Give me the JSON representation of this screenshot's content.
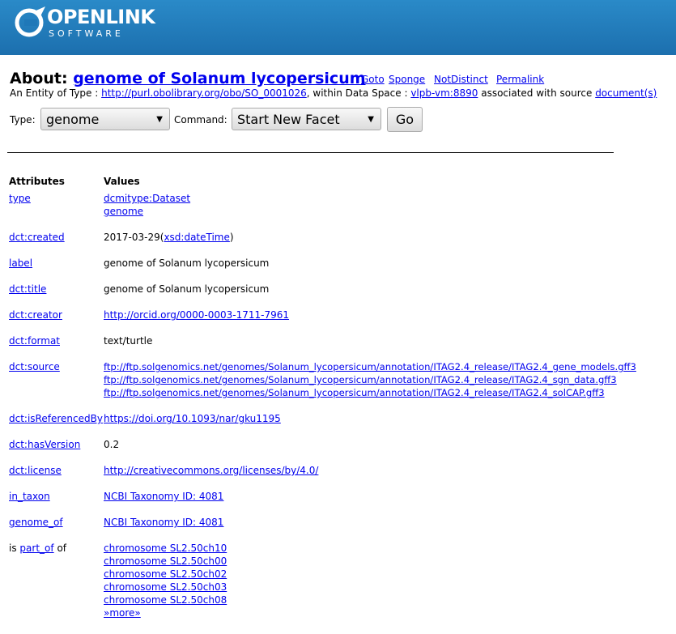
{
  "brand": {
    "name": "OPENLINK",
    "sub": "SOFTWARE"
  },
  "header": {
    "about_prefix": "About:",
    "title": "genome of Solanum lycopersicum",
    "links": [
      "Goto",
      "Sponge",
      "NotDistinct",
      "Permalink"
    ]
  },
  "entity": {
    "prefix": "An Entity of Type :",
    "type_link": "http://purl.obolibrary.org/obo/SO_0001026",
    "middle": ", within Data Space :",
    "space_link": "vlpb-vm:8890",
    "after": "associated with source",
    "source_link": "document(s)"
  },
  "form": {
    "type_label": "Type:",
    "type_value": "genome",
    "command_label": "Command:",
    "command_value": "Start New Facet",
    "go_label": "Go"
  },
  "table": {
    "col_attr": "Attributes",
    "col_val": "Values",
    "rows": [
      {
        "attr": "type",
        "values": [
          "dcmitype:Dataset",
          "genome"
        ]
      },
      {
        "attr": "dct:created",
        "values": []
      },
      {
        "attr": "label",
        "values": [
          "genome of Solanum lycopersicum"
        ]
      },
      {
        "attr": "dct:title",
        "values": [
          "genome of Solanum lycopersicum"
        ]
      },
      {
        "attr": "dct:creator",
        "values": [
          "http://orcid.org/0000-0003-1711-7961"
        ]
      },
      {
        "attr": "dct:format",
        "values": [
          "text/turtle"
        ]
      },
      {
        "attr": "dct:source",
        "values": [
          "ftp://ftp.solgenomics.net/genomes/Solanum_lycopersicum/annotation/ITAG2.4_release/ITAG2.4_gene_models.gff3",
          "ftp://ftp.solgenomics.net/genomes/Solanum_lycopersicum/annotation/ITAG2.4_release/ITAG2.4_sgn_data.gff3",
          "ftp://ftp.solgenomics.net/genomes/Solanum_lycopersicum/annotation/ITAG2.4_release/ITAG2.4_solCAP.gff3"
        ]
      },
      {
        "attr": "dct:isReferencedBy",
        "values": [
          "https://doi.org/10.1093/nar/gku1195"
        ]
      },
      {
        "attr": "dct:hasVersion",
        "values": [
          "0.2"
        ]
      },
      {
        "attr": "dct:license",
        "values": [
          "http://creativecommons.org/licenses/by/4.0/"
        ]
      },
      {
        "attr": "in_taxon",
        "values": [
          "NCBI Taxonomy ID: 4081"
        ]
      },
      {
        "attr": "genome_of",
        "values": [
          "NCBI Taxonomy ID: 4081"
        ]
      },
      {
        "attr": "part_of",
        "values": [
          "chromosome SL2.50ch10",
          "chromosome SL2.50ch00",
          "chromosome SL2.50ch02",
          "chromosome SL2.50ch03",
          "chromosome SL2.50ch08",
          "»more»"
        ]
      }
    ],
    "created": {
      "date": "2017-03-29",
      "open": "(",
      "type": "xsd:dateTime",
      "close": ")"
    },
    "inverse": {
      "prefix": "is",
      "suffix": "of"
    }
  }
}
